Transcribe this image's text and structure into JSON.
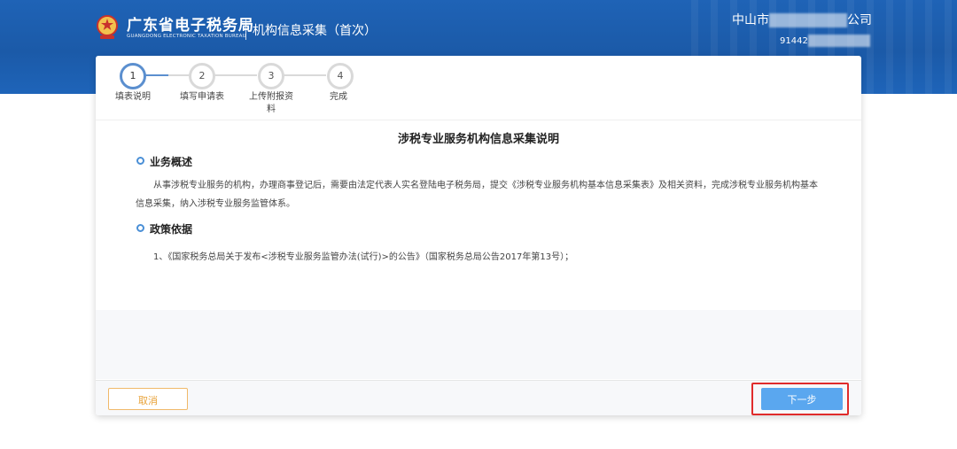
{
  "header": {
    "logo_title": "广东省电子税务局",
    "logo_subtitle": "GUANGDONG ELECTRONIC TAXATION BUREAU",
    "page_name": "机构信息采集（首次）",
    "company_prefix": "中山市",
    "company_suffix": "公司",
    "taxid_prefix": "91442",
    "emblem_icon": "tax-emblem-icon"
  },
  "steps": [
    {
      "number": "1",
      "label": "填表说明",
      "active": true
    },
    {
      "number": "2",
      "label": "填写申请表",
      "active": false
    },
    {
      "number": "3",
      "label": "上传附报资料",
      "active": false
    },
    {
      "number": "4",
      "label": "完成",
      "active": false
    }
  ],
  "content": {
    "title": "涉税专业服务机构信息采集说明",
    "sections": [
      {
        "heading": "业务概述",
        "text": "从事涉税专业服务的机构，办理商事登记后，需要由法定代表人实名登陆电子税务局，提交《涉税专业服务机构基本信息采集表》及相关资料，完成涉税专业服务机构基本信息采集，纳入涉税专业服务监管体系。"
      },
      {
        "heading": "政策依据",
        "text": "1、《国家税务总局关于发布<涉税专业服务监管办法(试行)>的公告》（国家税务总局公告2017年第13号）；"
      }
    ]
  },
  "footer": {
    "cancel_label": "取消",
    "next_label": "下一步"
  },
  "colors": {
    "header_blue": "#1b5aa8",
    "step_active": "#5b8fcf",
    "next_button": "#5aa7ef",
    "cancel_border": "#f0b96a",
    "highlight_red": "#e02b2b"
  }
}
